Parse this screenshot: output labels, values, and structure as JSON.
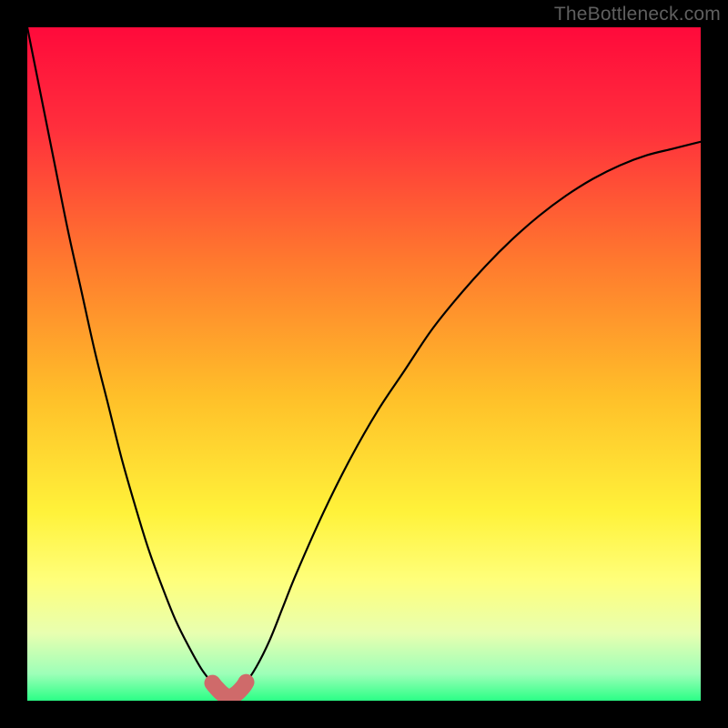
{
  "watermark": "TheBottleneck.com",
  "colors": {
    "frame": "#000000",
    "curve_main": "#000000",
    "curve_highlight": "#cf6a6a",
    "gradient_stops": [
      {
        "offset": 0.0,
        "color": "#ff0a3b"
      },
      {
        "offset": 0.15,
        "color": "#ff2f3c"
      },
      {
        "offset": 0.35,
        "color": "#ff7a2e"
      },
      {
        "offset": 0.55,
        "color": "#ffc029"
      },
      {
        "offset": 0.72,
        "color": "#fff23a"
      },
      {
        "offset": 0.82,
        "color": "#ffff7a"
      },
      {
        "offset": 0.9,
        "color": "#e8ffb0"
      },
      {
        "offset": 0.96,
        "color": "#9dffb8"
      },
      {
        "offset": 1.0,
        "color": "#2bff86"
      }
    ]
  },
  "chart_data": {
    "type": "line",
    "title": "",
    "xlabel": "",
    "ylabel": "",
    "xlim": [
      0,
      100
    ],
    "ylim": [
      0,
      100
    ],
    "x": [
      0,
      2,
      4,
      6,
      8,
      10,
      12,
      14,
      16,
      18,
      20,
      22,
      24,
      26,
      28,
      29,
      30,
      31,
      32,
      34,
      36,
      38,
      40,
      44,
      48,
      52,
      56,
      60,
      64,
      68,
      72,
      76,
      80,
      84,
      88,
      92,
      96,
      100
    ],
    "values": [
      100,
      90,
      80,
      70,
      61,
      52,
      44,
      36,
      29,
      22.5,
      17,
      12,
      8,
      4.5,
      2,
      1,
      0.5,
      1,
      2,
      5,
      9,
      14,
      19,
      28,
      36,
      43,
      49,
      55,
      60,
      64.5,
      68.5,
      72,
      75,
      77.5,
      79.5,
      81,
      82,
      83
    ],
    "highlight_range_x": [
      27.5,
      32.5
    ],
    "grid": false,
    "legend": false
  }
}
